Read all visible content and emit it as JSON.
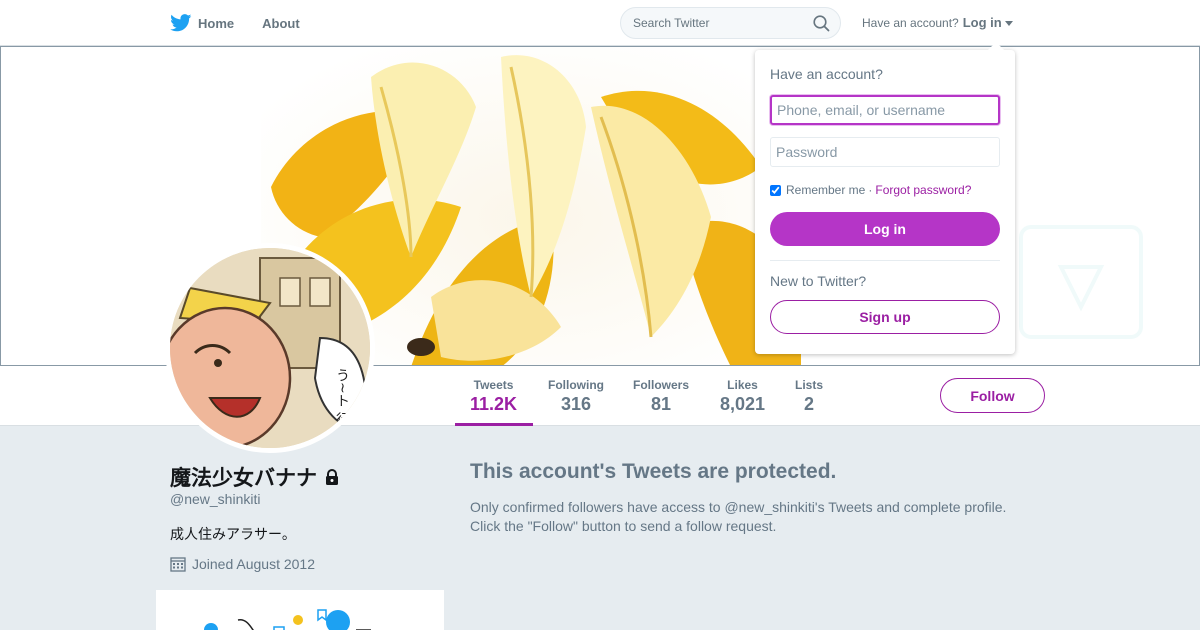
{
  "nav": {
    "home_label": "Home",
    "about_label": "About",
    "search_placeholder": "Search Twitter",
    "account_prompt": "Have an account?",
    "login_label": "Log in"
  },
  "login_dropdown": {
    "title": "Have an account?",
    "username_placeholder": "Phone, email, or username",
    "password_placeholder": "Password",
    "remember_label": "Remember me",
    "separator": "·",
    "forgot_label": "Forgot password?",
    "remember_checked": true,
    "login_button": "Log in",
    "new_prompt": "New to Twitter?",
    "signup_button": "Sign up"
  },
  "stats": [
    {
      "label": "Tweets",
      "value": "11.2K"
    },
    {
      "label": "Following",
      "value": "316"
    },
    {
      "label": "Followers",
      "value": "81"
    },
    {
      "label": "Likes",
      "value": "8,021"
    },
    {
      "label": "Lists",
      "value": "2"
    }
  ],
  "follow_button": "Follow",
  "profile": {
    "name": "魔法少女バナナ",
    "handle": "@new_shinkiti",
    "bio": "成人住みアラサー。",
    "joined": "Joined August 2012",
    "avatar_caption": "う~ト 行きたい"
  },
  "protected": {
    "title": "This account's Tweets are protected.",
    "line1": "Only confirmed followers have access to @new_shinkiti's Tweets and complete profile.",
    "line2": "Click the \"Follow\" button to send a follow request."
  },
  "colors": {
    "accent": "#9b1fa3",
    "login_button": "#b535c7",
    "twitter_blue": "#1da1f2",
    "page_bg": "#e6ecf0"
  },
  "icons": [
    "twitter-bird-icon",
    "search-icon",
    "caret-down-icon",
    "lock-icon",
    "calendar-icon"
  ]
}
